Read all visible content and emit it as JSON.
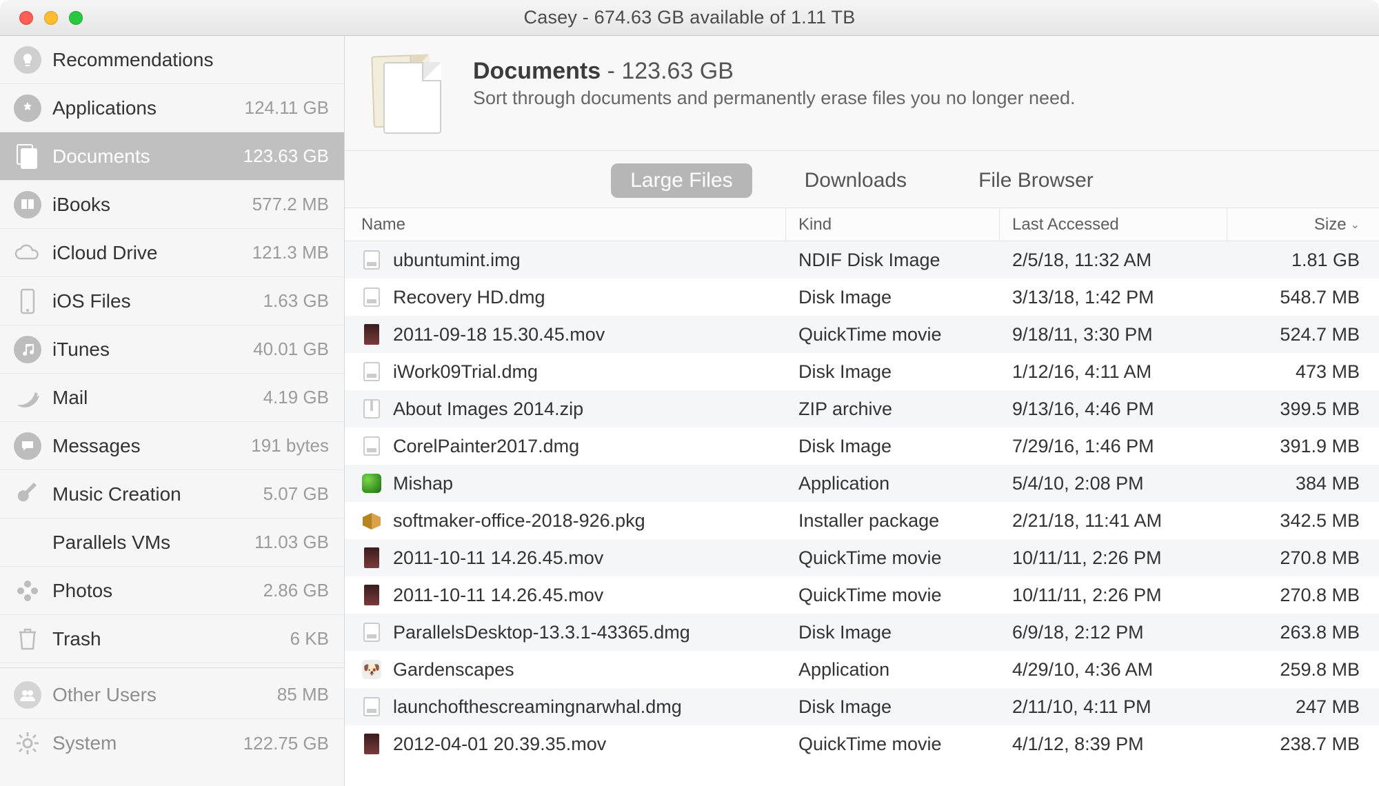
{
  "window": {
    "title": "Casey - 674.63 GB available of 1.11 TB"
  },
  "sidebar": {
    "items": [
      {
        "label": "Recommendations",
        "size": "",
        "icon": "lightbulb"
      },
      {
        "label": "Applications",
        "size": "124.11 GB",
        "icon": "appstore"
      },
      {
        "label": "Documents",
        "size": "123.63 GB",
        "icon": "documents",
        "selected": true
      },
      {
        "label": "iBooks",
        "size": "577.2 MB",
        "icon": "book"
      },
      {
        "label": "iCloud Drive",
        "size": "121.3 MB",
        "icon": "cloud"
      },
      {
        "label": "iOS Files",
        "size": "1.63 GB",
        "icon": "phone"
      },
      {
        "label": "iTunes",
        "size": "40.01 GB",
        "icon": "music"
      },
      {
        "label": "Mail",
        "size": "4.19 GB",
        "icon": "bird"
      },
      {
        "label": "Messages",
        "size": "191 bytes",
        "icon": "chat"
      },
      {
        "label": "Music Creation",
        "size": "5.07 GB",
        "icon": "guitar"
      },
      {
        "label": "Parallels VMs",
        "size": "11.03 GB",
        "icon": "none"
      },
      {
        "label": "Photos",
        "size": "2.86 GB",
        "icon": "flower"
      },
      {
        "label": "Trash",
        "size": "6 KB",
        "icon": "trash"
      }
    ],
    "footer_items": [
      {
        "label": "Other Users",
        "size": "85 MB",
        "icon": "users"
      },
      {
        "label": "System",
        "size": "122.75 GB",
        "icon": "gear"
      }
    ]
  },
  "header": {
    "title": "Documents",
    "size": "123.63 GB",
    "subtitle": "Sort through documents and permanently erase files you no longer need."
  },
  "tabs": [
    {
      "label": "Large Files",
      "active": true
    },
    {
      "label": "Downloads",
      "active": false
    },
    {
      "label": "File Browser",
      "active": false
    }
  ],
  "columns": {
    "name": "Name",
    "kind": "Kind",
    "last": "Last Accessed",
    "size": "Size",
    "sort_caret": "⌄"
  },
  "rows": [
    {
      "name": "ubuntumint.img",
      "kind": "NDIF Disk Image",
      "last": "2/5/18, 11:32 AM",
      "size": "1.81 GB",
      "icon": "disk"
    },
    {
      "name": "Recovery HD.dmg",
      "kind": "Disk Image",
      "last": "3/13/18, 1:42 PM",
      "size": "548.7 MB",
      "icon": "disk"
    },
    {
      "name": "2011-09-18 15.30.45.mov",
      "kind": "QuickTime movie",
      "last": "9/18/11, 3:30 PM",
      "size": "524.7 MB",
      "icon": "thumb-dark"
    },
    {
      "name": "iWork09Trial.dmg",
      "kind": "Disk Image",
      "last": "1/12/16, 4:11 AM",
      "size": "473 MB",
      "icon": "disk"
    },
    {
      "name": "About Images 2014.zip",
      "kind": "ZIP archive",
      "last": "9/13/16, 4:46 PM",
      "size": "399.5 MB",
      "icon": "zip"
    },
    {
      "name": "CorelPainter2017.dmg",
      "kind": "Disk Image",
      "last": "7/29/16, 1:46 PM",
      "size": "391.9 MB",
      "icon": "disk"
    },
    {
      "name": "Mishap",
      "kind": "Application",
      "last": "5/4/10, 2:08 PM",
      "size": "384 MB",
      "icon": "app-green"
    },
    {
      "name": "softmaker-office-2018-926.pkg",
      "kind": "Installer package",
      "last": "2/21/18, 11:41 AM",
      "size": "342.5 MB",
      "icon": "pkg"
    },
    {
      "name": "2011-10-11 14.26.45.mov",
      "kind": "QuickTime movie",
      "last": "10/11/11, 2:26 PM",
      "size": "270.8 MB",
      "icon": "thumb-dark"
    },
    {
      "name": "2011-10-11 14.26.45.mov",
      "kind": "QuickTime movie",
      "last": "10/11/11, 2:26 PM",
      "size": "270.8 MB",
      "icon": "thumb-dark"
    },
    {
      "name": "ParallelsDesktop-13.3.1-43365.dmg",
      "kind": "Disk Image",
      "last": "6/9/18, 2:12 PM",
      "size": "263.8 MB",
      "icon": "disk"
    },
    {
      "name": "Gardenscapes",
      "kind": "Application",
      "last": "4/29/10, 4:36 AM",
      "size": "259.8 MB",
      "icon": "app-dog"
    },
    {
      "name": "launchofthescreamingnarwhal.dmg",
      "kind": "Disk Image",
      "last": "2/11/10, 4:11 PM",
      "size": "247 MB",
      "icon": "disk"
    },
    {
      "name": "2012-04-01 20.39.35.mov",
      "kind": "QuickTime movie",
      "last": "4/1/12, 8:39 PM",
      "size": "238.7 MB",
      "icon": "thumb-dark"
    }
  ]
}
